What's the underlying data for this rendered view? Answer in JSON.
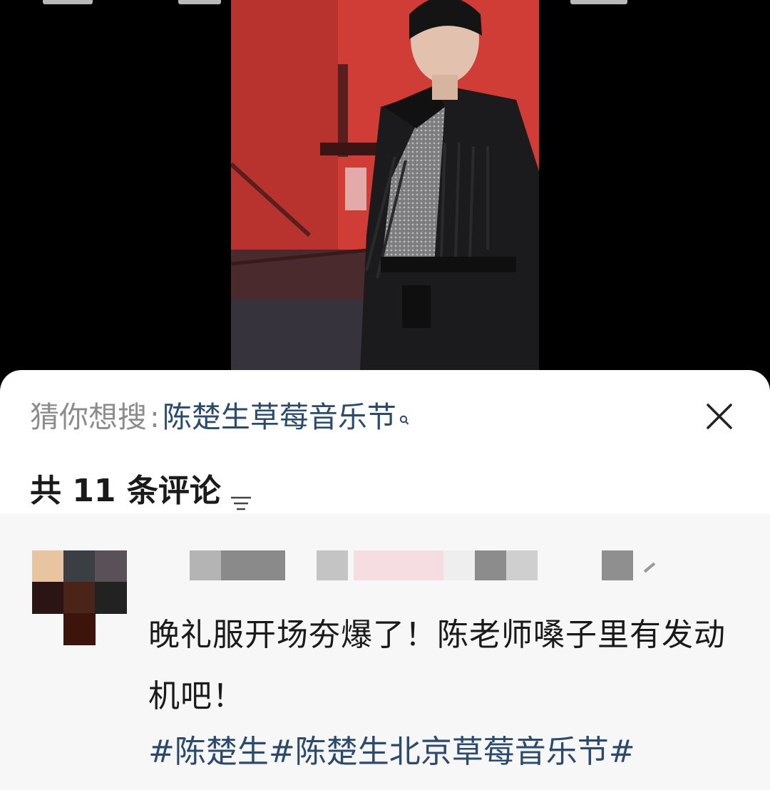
{
  "video": {
    "description_icon": "video-frame"
  },
  "suggest": {
    "prefix": "猜你想搜",
    "colon": ":",
    "query": "陈楚生草莓音乐节",
    "search_icon": "search-icon",
    "close_icon": "close-icon"
  },
  "comments": {
    "count_label": "共 11 条评论",
    "sort_icon": "sort-icon",
    "items": [
      {
        "text": "晚礼服开场夯爆了！陈老师嗓子里有发动机吧！",
        "hashtags": [
          "#陈楚生",
          "#陈楚生北京草莓音乐节",
          "#"
        ]
      }
    ]
  },
  "colors": {
    "link": "#2c4a6b",
    "muted": "#8c8c8c",
    "text": "#1a1a1a",
    "list_bg": "#f7f7f7"
  }
}
